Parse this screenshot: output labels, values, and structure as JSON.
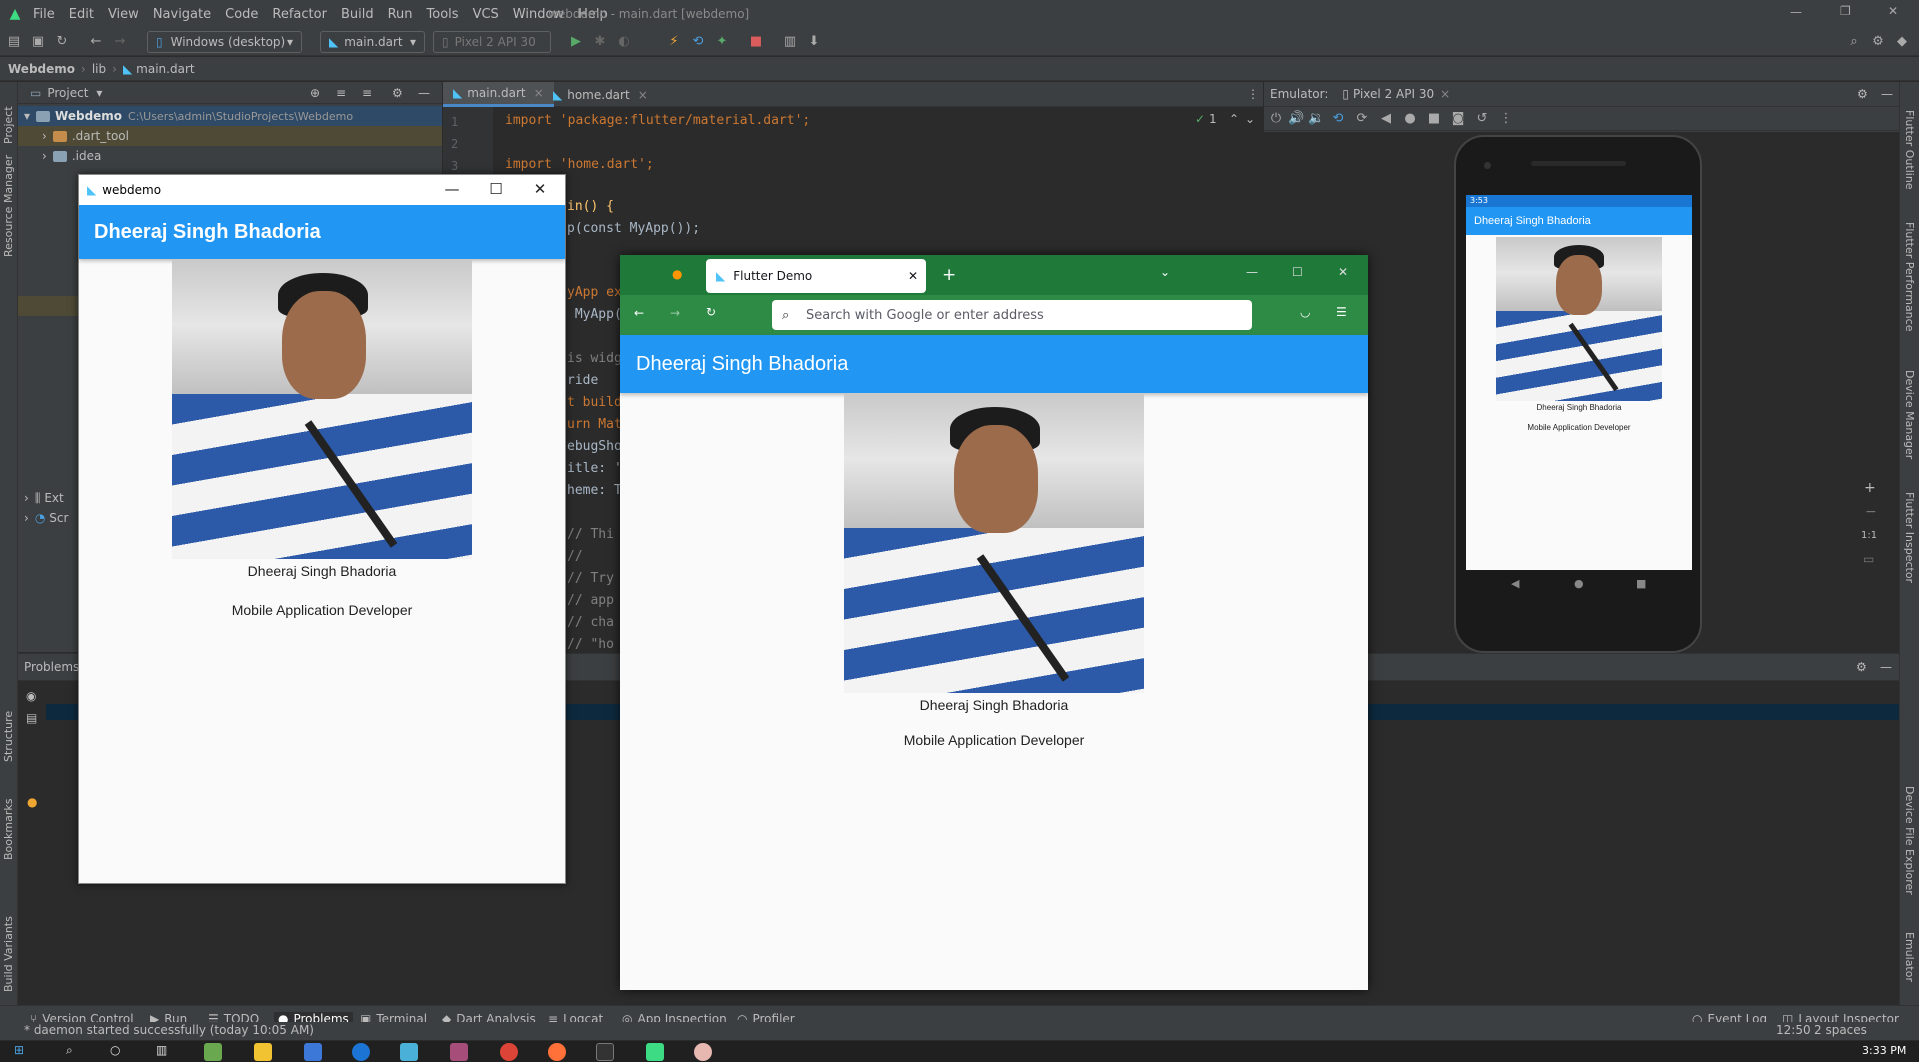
{
  "ide": {
    "window_title": "webdemo - main.dart [webdemo]",
    "menu": [
      "File",
      "Edit",
      "View",
      "Navigate",
      "Code",
      "Refactor",
      "Build",
      "Run",
      "Tools",
      "VCS",
      "Window",
      "Help"
    ],
    "toolbar": {
      "device_combo": "Windows (desktop)",
      "config_combo": "main.dart",
      "emulator_combo": "Pixel 2 API 30"
    },
    "breadcrumb": [
      "Webdemo",
      "lib",
      "main.dart"
    ],
    "left_tabs": [
      "Project",
      "Resource Manager",
      "Structure",
      "Bookmarks",
      "Build Variants"
    ],
    "right_tabs": [
      "Flutter Outline",
      "Flutter Performance",
      "Device Manager",
      "Flutter Inspector",
      "Device File Explorer",
      "Emulator"
    ],
    "project": {
      "header": "Project",
      "root_label": "Webdemo",
      "root_path": "C:\\Users\\admin\\StudioProjects\\Webdemo",
      "items": [
        ".dart_tool",
        ".idea"
      ],
      "ext_label": "Ext",
      "scr_label": "Scr"
    },
    "editor": {
      "tabs": [
        "main.dart",
        "home.dart"
      ],
      "warning_count": "1",
      "lines": [
        {
          "n": "1",
          "text": "import 'package:flutter/material.dart';"
        },
        {
          "n": "2",
          "text": ""
        },
        {
          "n": "3",
          "text": "import 'home.dart';"
        }
      ],
      "partial_lines": [
        "in() {",
        "p(const MyApp());",
        "yApp ex",
        " MyApp(",
        "is widg",
        "ride",
        "t build",
        "urn Mat",
        "ebugSho",
        "itle: '",
        "heme: T",
        "// Thi",
        "//",
        "// Try",
        "// app",
        "// cha",
        "// \"ho"
      ]
    },
    "emulator": {
      "label": "Emulator:",
      "device_tab": "Pixel 2 API 30",
      "zoom_label": "1:1",
      "phone": {
        "status_time": "3:53",
        "appbar_title": "Dheeraj Singh Bhadoria",
        "name": "Dheeraj Singh Bhadoria",
        "role": "Mobile Application Developer"
      }
    },
    "bottom_panel": {
      "title": "Problems:"
    },
    "bottom_tools": [
      "Version Control",
      "Run",
      "TODO",
      "Problems",
      "Terminal",
      "Dart Analysis",
      "Logcat",
      "App Inspection",
      "Profiler"
    ],
    "right_tools": [
      "Event Log",
      "Layout Inspector"
    ],
    "status": {
      "message": "* daemon started successfully (today 10:05 AM)",
      "position": "12:50",
      "indent": "2 spaces"
    },
    "taskbar_time": "3:33 PM"
  },
  "desktop_app": {
    "window_title": "webdemo",
    "appbar_title": "Dheeraj Singh Bhadoria",
    "name": "Dheeraj Singh Bhadoria",
    "role": "Mobile Application Developer"
  },
  "browser": {
    "tab_title": "Flutter Demo",
    "url_placeholder": "Search with Google or enter address",
    "appbar_title": "Dheeraj Singh Bhadoria",
    "name": "Dheeraj Singh Bhadoria",
    "role": "Mobile Application Developer"
  },
  "colors": {
    "flutter_blue": "#2196f3",
    "firefox_green": "#1f7a3a",
    "ide_bg": "#2b2b2b",
    "ide_panel": "#3c3f41"
  }
}
